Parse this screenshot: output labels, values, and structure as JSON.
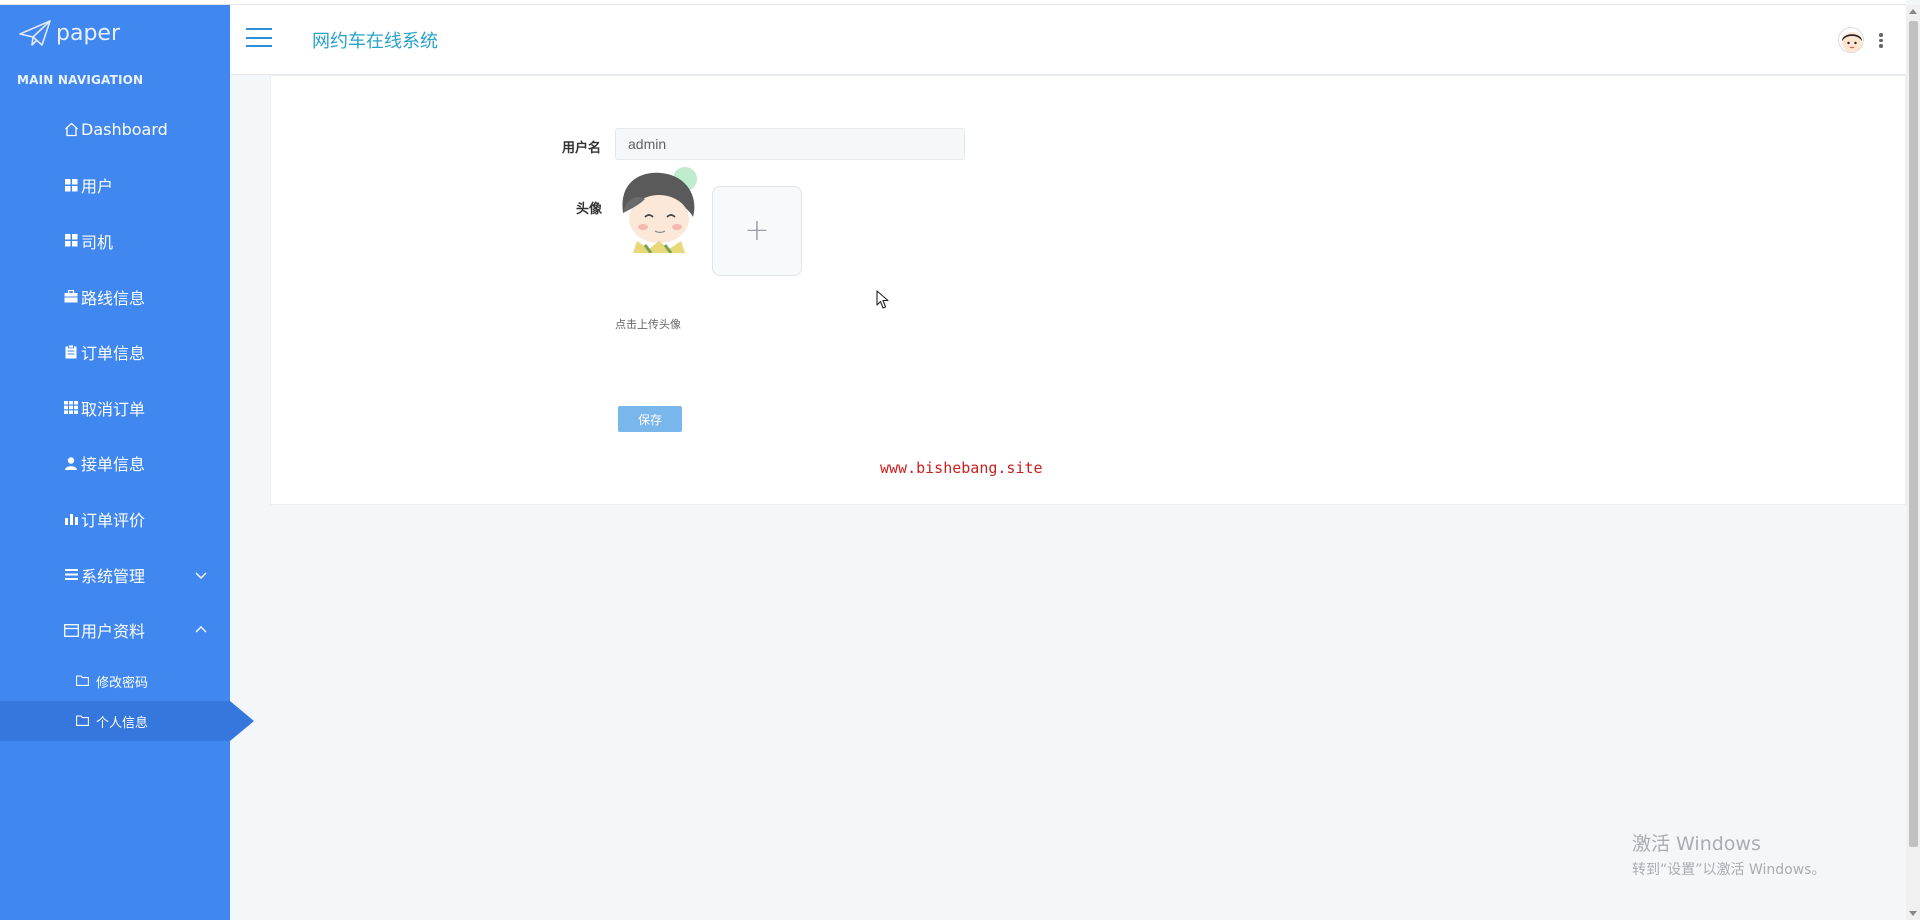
{
  "brand": {
    "name": "paper"
  },
  "sidebar": {
    "header": "MAIN NAVIGATION",
    "items": [
      {
        "label": "Dashboard",
        "icon": "home-icon"
      },
      {
        "label": "用户",
        "icon": "grid-icon"
      },
      {
        "label": "司机",
        "icon": "grid-icon"
      },
      {
        "label": "路线信息",
        "icon": "briefcase-icon"
      },
      {
        "label": "订单信息",
        "icon": "clipboard-icon"
      },
      {
        "label": "取消订单",
        "icon": "table-icon"
      },
      {
        "label": "接单信息",
        "icon": "user-icon"
      },
      {
        "label": "订单评价",
        "icon": "bar-chart-icon"
      },
      {
        "label": "系统管理",
        "icon": "list-icon"
      },
      {
        "label": "用户资料",
        "icon": "card-icon"
      }
    ],
    "sub_items": [
      {
        "label": "修改密码",
        "icon": "folder-icon"
      },
      {
        "label": "个人信息",
        "icon": "folder-icon"
      }
    ]
  },
  "header": {
    "title": "网约车在线系统"
  },
  "form": {
    "username_label": "用户名",
    "username_value": "admin",
    "avatar_label": "头像",
    "upload_hint": "点击上传头像",
    "save_label": "保存"
  },
  "watermark": "www.bishebang.site",
  "windows_activation": {
    "line1": "激活 Windows",
    "line2": "转到“设置”以激活 Windows。"
  },
  "colors": {
    "sidebar_bg": "#4087ef",
    "sidebar_active": "#3677dd",
    "title_color": "#27a3c9",
    "save_button": "#79b6ec",
    "watermark": "#c9211e"
  }
}
